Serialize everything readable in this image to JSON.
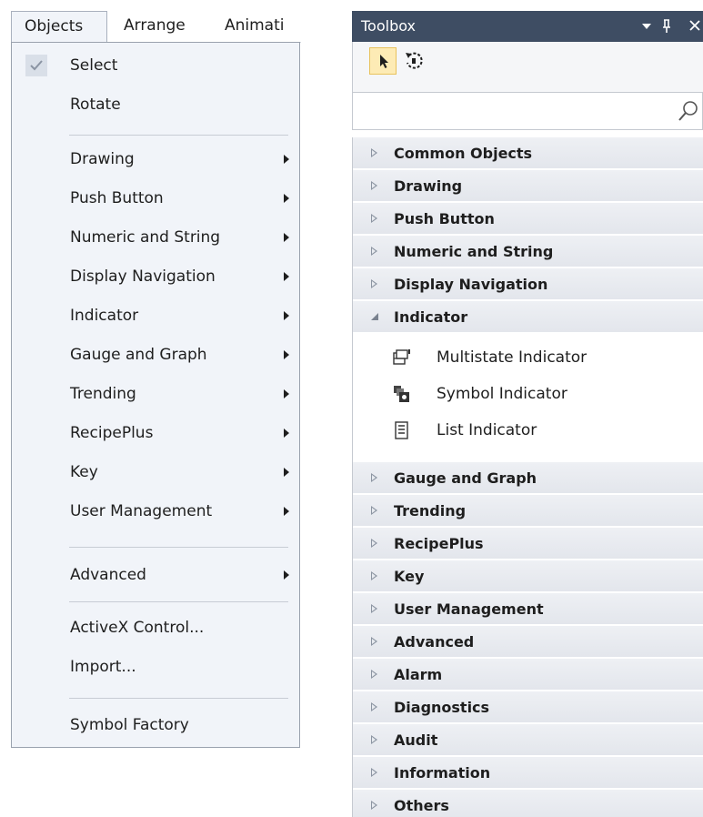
{
  "menubar": {
    "items": [
      {
        "label": "Objects"
      },
      {
        "label": "Arrange"
      },
      {
        "label": "Animati"
      }
    ]
  },
  "objects_menu": {
    "items": [
      {
        "label": "Select",
        "checked": true
      },
      {
        "label": "Rotate"
      },
      {
        "label": "Drawing",
        "submenu": true
      },
      {
        "label": "Push Button",
        "submenu": true
      },
      {
        "label": "Numeric and String",
        "submenu": true
      },
      {
        "label": "Display Navigation",
        "submenu": true
      },
      {
        "label": "Indicator",
        "submenu": true
      },
      {
        "label": "Gauge and Graph",
        "submenu": true
      },
      {
        "label": "Trending",
        "submenu": true
      },
      {
        "label": "RecipePlus",
        "submenu": true
      },
      {
        "label": "Key",
        "submenu": true
      },
      {
        "label": "User Management",
        "submenu": true
      },
      {
        "label": "Advanced",
        "submenu": true
      },
      {
        "label": "ActiveX Control..."
      },
      {
        "label": "Import..."
      },
      {
        "label": "Symbol Factory"
      }
    ]
  },
  "toolbox": {
    "title": "Toolbox",
    "title_icons": [
      "dropdown-arrow-icon",
      "pin-icon",
      "close-icon"
    ],
    "tools": [
      "pointer-icon",
      "rotate-icon"
    ],
    "search_placeholder": "",
    "categories": [
      {
        "label": "Common Objects",
        "expanded": false
      },
      {
        "label": "Drawing",
        "expanded": false
      },
      {
        "label": "Push Button",
        "expanded": false
      },
      {
        "label": "Numeric and String",
        "expanded": false
      },
      {
        "label": "Display Navigation",
        "expanded": false
      },
      {
        "label": "Indicator",
        "expanded": true,
        "children": [
          {
            "label": "Multistate Indicator",
            "icon": "multistate-indicator-icon"
          },
          {
            "label": "Symbol Indicator",
            "icon": "symbol-indicator-icon"
          },
          {
            "label": "List Indicator",
            "icon": "list-indicator-icon"
          }
        ]
      },
      {
        "label": "Gauge and Graph",
        "expanded": false
      },
      {
        "label": "Trending",
        "expanded": false
      },
      {
        "label": "RecipePlus",
        "expanded": false
      },
      {
        "label": "Key",
        "expanded": false
      },
      {
        "label": "User Management",
        "expanded": false
      },
      {
        "label": "Advanced",
        "expanded": false
      },
      {
        "label": "Alarm",
        "expanded": false
      },
      {
        "label": "Diagnostics",
        "expanded": false
      },
      {
        "label": "Audit",
        "expanded": false
      },
      {
        "label": "Information",
        "expanded": false
      },
      {
        "label": "Others",
        "expanded": false
      }
    ]
  },
  "colors": {
    "toolbox_title_bg": "#3e4d63",
    "selected_tool_bg": "#fdebb5",
    "menu_bg": "#f1f4f9"
  }
}
